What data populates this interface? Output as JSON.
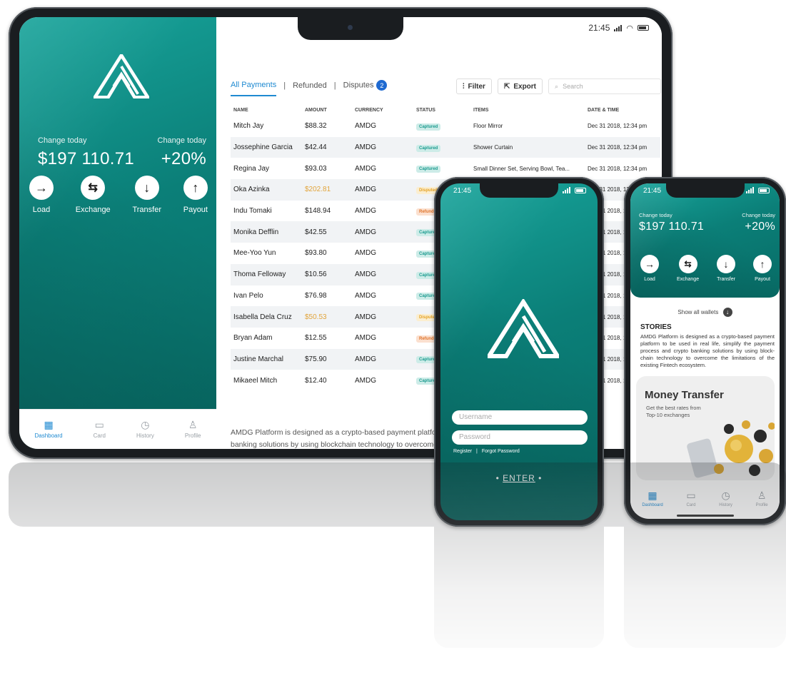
{
  "status": {
    "time": "21:45"
  },
  "wallet": {
    "left_label": "Change today",
    "amount": "$197 110.71",
    "right_label": "Change today",
    "percent": "+20%"
  },
  "actions": [
    {
      "label": "Load",
      "icon": "arrow-right-icon"
    },
    {
      "label": "Exchange",
      "icon": "exchange-icon"
    },
    {
      "label": "Transfer",
      "icon": "arrow-down-icon"
    },
    {
      "label": "Payout",
      "icon": "arrow-up-icon"
    }
  ],
  "nav": [
    {
      "label": "Dashboard",
      "icon": "dashboard-icon",
      "active": true
    },
    {
      "label": "Card",
      "icon": "card-icon"
    },
    {
      "label": "History",
      "icon": "history-icon"
    },
    {
      "label": "Profile",
      "icon": "profile-icon"
    }
  ],
  "tabs": {
    "all": "All Payments",
    "refunded": "Refunded",
    "disputes": "Disputes",
    "disputes_count": "2",
    "sep": "|"
  },
  "toolbar": {
    "filter": "Filter",
    "export": "Export",
    "search_placeholder": "Search"
  },
  "table": {
    "columns": [
      "NAME",
      "AMOUNT",
      "CURRENCY",
      "STATUS",
      "ITEMS",
      "DATE & TIME"
    ],
    "rows": [
      {
        "name": "Mitch Jay",
        "amount": "$88.32",
        "currency": "AMDG",
        "status": "Captured",
        "items": "Floor Mirror",
        "date": "Dec 31 2018, 12:34 pm"
      },
      {
        "name": "Jossephine Garcia",
        "amount": "$42.44",
        "currency": "AMDG",
        "status": "Captured",
        "items": "Shower Curtain",
        "date": "Dec 31 2018, 12:34 pm"
      },
      {
        "name": "Regina Jay",
        "amount": "$93.03",
        "currency": "AMDG",
        "status": "Captured",
        "items": "Small Dinner Set, Serving Bowl, Tea...",
        "date": "Dec 31 2018, 12:34 pm"
      },
      {
        "name": "Oka Azinka",
        "amount": "$202.81",
        "currency": "AMDG",
        "status": "Disputed",
        "items": "",
        "date": "Dec 31 2018, 12:34 pm",
        "highlight": true
      },
      {
        "name": "Indu Tomaki",
        "amount": "$148.94",
        "currency": "AMDG",
        "status": "Refunded",
        "items": "",
        "date": "Dec 31 2018, 12:34 pm"
      },
      {
        "name": "Monika Defflin",
        "amount": "$42.55",
        "currency": "AMDG",
        "status": "Captured",
        "items": "",
        "date": "Dec 31 2018, 12:34 pm"
      },
      {
        "name": "Mee-Yoo Yun",
        "amount": "$93.80",
        "currency": "AMDG",
        "status": "Captured",
        "items": "",
        "date": "Dec 31 2018, 12:34 pm"
      },
      {
        "name": "Thoma Felloway",
        "amount": "$10.56",
        "currency": "AMDG",
        "status": "Captured",
        "items": "",
        "date": "Dec 31 2018, 12:34 pm"
      },
      {
        "name": "Ivan Pelo",
        "amount": "$76.98",
        "currency": "AMDG",
        "status": "Captured",
        "items": "",
        "date": "Dec 31 2018, 12:34 pm"
      },
      {
        "name": "Isabella Dela Cruz",
        "amount": "$50.53",
        "currency": "AMDG",
        "status": "Disputed",
        "items": "",
        "date": "Dec 31 2018, 12:34 pm",
        "highlight": true
      },
      {
        "name": "Bryan Adam",
        "amount": "$12.55",
        "currency": "AMDG",
        "status": "Refunded",
        "items": "",
        "date": "Dec 31 2018, 12:34 pm"
      },
      {
        "name": "Justine Marchal",
        "amount": "$75.90",
        "currency": "AMDG",
        "status": "Captured",
        "items": "",
        "date": "Dec 31 2018, 12:34 pm"
      },
      {
        "name": "Mikaeel Mitch",
        "amount": "$12.40",
        "currency": "AMDG",
        "status": "Captured",
        "items": "",
        "date": "Dec 31 2018, 12:34 pm"
      }
    ]
  },
  "description": {
    "line1": "AMDG Platform is designed as a crypto-based payment platform",
    "line2": "banking solutions by using blockchain technology to overcome"
  },
  "login": {
    "username_placeholder": "Username",
    "password_placeholder": "Password",
    "register": "Register",
    "sep": "|",
    "forgot": "Forgot Password",
    "enter": "ENTER",
    "enter_dot": "•"
  },
  "mobile": {
    "show_wallets": "Show all wallets",
    "stories_title": "STORIES",
    "stories_text": "AMDG Platform is designed as a crypto-based payment platform to be used in real life, simplify the payment process and crypto banking solutions by using block-chain technology to overcome the limitations of the existing Fintech ecosystem.",
    "promo_title": "Money Transfer",
    "promo_sub1": "Get the best rates from",
    "promo_sub2": "Top-10 exchanges"
  },
  "colors": {
    "teal": "#0b7f78",
    "accent": "#1f8ad1",
    "captured": "#1c9b8f",
    "disputed": "#e5a224",
    "refunded": "#e0762d"
  }
}
